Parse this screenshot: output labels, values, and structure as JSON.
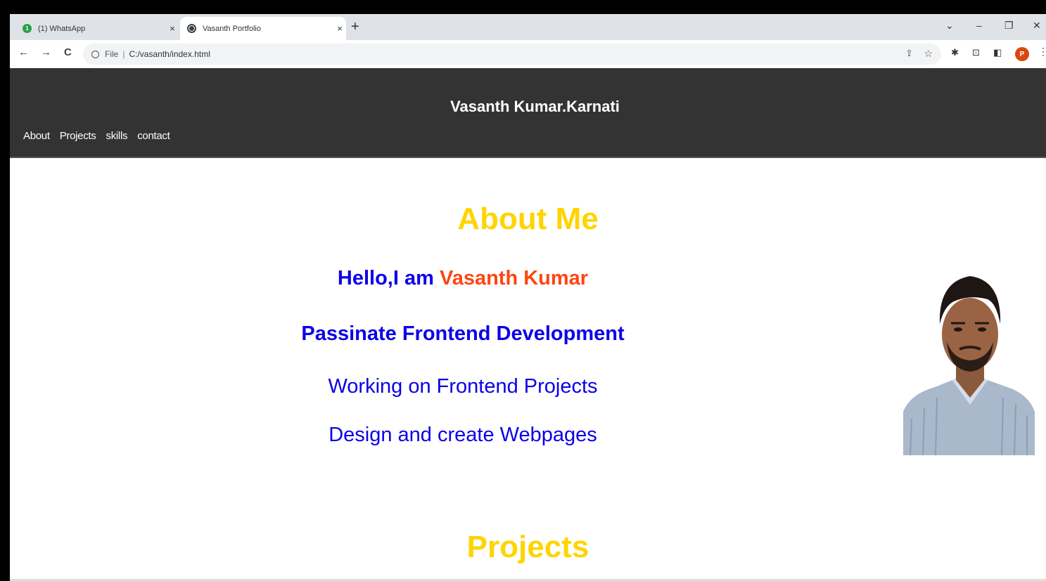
{
  "browser": {
    "tabs": [
      {
        "title": "(1) WhatsApp",
        "badge": "1"
      },
      {
        "title": "Vasanth Portfolio"
      }
    ],
    "new_tab": "+",
    "close_glyph": "×",
    "window_controls": {
      "list": "⌄",
      "minimize": "–",
      "restore": "❐",
      "close": "✕"
    },
    "nav": {
      "back": "←",
      "forward": "→",
      "reload": "C"
    },
    "address": {
      "scheme": "File",
      "separator": "|",
      "path": "C:/vasanth/index.html"
    },
    "profile_initial": "P",
    "toolbar_icons": [
      "share-icon",
      "star-icon",
      "extensions-icon",
      "save-icon",
      "sidepanel-icon",
      "menu-icon"
    ]
  },
  "site": {
    "title": "Vasanth Kumar.Karnati",
    "nav": [
      "About",
      "Projects",
      "skills",
      "contact"
    ]
  },
  "about": {
    "heading": "About Me",
    "greeting_prefix": "Hello,I am ",
    "greeting_name": "Vasanth Kumar",
    "role": "Passinate Frontend Development",
    "line1": "Working on Frontend Projects",
    "line2": "Design and create Webpages"
  },
  "projects": {
    "heading": "Projects"
  },
  "colors": {
    "header_bg": "#333333",
    "heading_yellow": "#ffd400",
    "text_blue": "#0b00e8",
    "name_orange": "#ff4512"
  }
}
